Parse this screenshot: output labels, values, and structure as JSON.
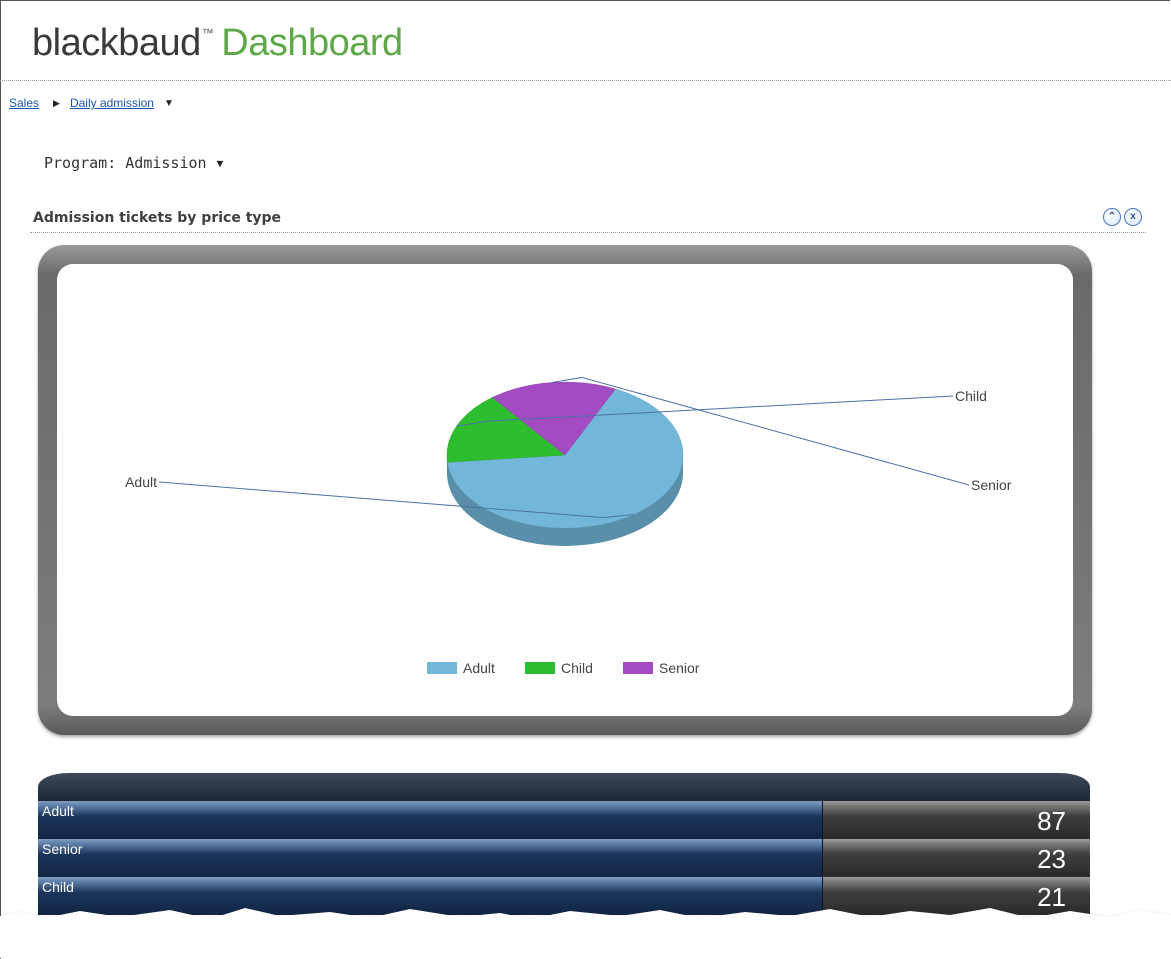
{
  "header": {
    "brand": "blackbaud",
    "trademark": "™",
    "app_name": "Dashboard"
  },
  "breadcrumb": {
    "items": [
      "Sales",
      "Daily admission"
    ]
  },
  "filter": {
    "program_label": "Program: Admission"
  },
  "panel": {
    "title": "Admission tickets by price type"
  },
  "colors": {
    "adult": "#72b7d9",
    "child": "#2ebd2e",
    "senior": "#a24bc3",
    "brand_green": "#5fa84a",
    "link": "#1a55b8"
  },
  "chart_data": {
    "type": "pie",
    "categories": [
      "Adult",
      "Child",
      "Senior"
    ],
    "values": [
      87,
      21,
      23
    ],
    "legend": [
      "Adult",
      "Child",
      "Senior"
    ],
    "legend_position": "bottom",
    "style": "3d"
  },
  "table": {
    "rows": [
      {
        "label": "Adult",
        "value": "87"
      },
      {
        "label": "Senior",
        "value": "23"
      },
      {
        "label": "Child",
        "value": "21"
      }
    ]
  }
}
